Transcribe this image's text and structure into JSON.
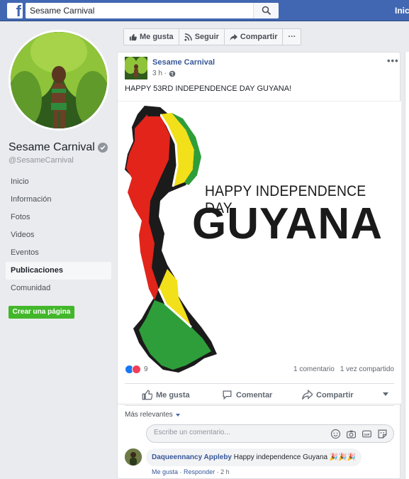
{
  "topbar": {
    "search_value": "Sesame Carnival",
    "right_link": "Inic"
  },
  "page": {
    "name": "Sesame Carnival",
    "handle": "@SesameCarnival",
    "nav": [
      {
        "label": "Inicio",
        "active": false
      },
      {
        "label": "Información",
        "active": false
      },
      {
        "label": "Fotos",
        "active": false
      },
      {
        "label": "Videos",
        "active": false
      },
      {
        "label": "Eventos",
        "active": false
      },
      {
        "label": "Publicaciones",
        "active": true
      },
      {
        "label": "Comunidad",
        "active": false
      }
    ],
    "create_page_label": "Crear una página"
  },
  "action_bar": {
    "like": "Me gusta",
    "follow": "Seguir",
    "share": "Compartir",
    "more": "···"
  },
  "post": {
    "author": "Sesame Carnival",
    "time": "3 h ·",
    "more": "•••",
    "text": "HAPPY 53RD INDEPENDENCE DAY GUYANA!",
    "image": {
      "line1": "HAPPY INDEPENDENCE DAY",
      "line2": "GUYANA"
    },
    "reaction_count": "9",
    "comments": "1 comentario",
    "shares": "1 vez compartido",
    "buttons": {
      "like": "Me gusta",
      "comment": "Comentar",
      "share": "Compartir"
    },
    "sort_label": "Más relevantes",
    "comment_placeholder": "Escribe un comentario...",
    "reply": {
      "name": "Daqueennancy Appleby",
      "text": "Happy independence Guyana",
      "emoji": "🎉🎉🎉",
      "like": "Me gusta",
      "reply": "Responder",
      "time": "2 h"
    }
  },
  "colors": {
    "brand": "#4267b2",
    "link": "#385898",
    "green": "#42b72a",
    "flag_green": "#2e9e3a",
    "flag_yellow": "#f2e01a",
    "flag_red": "#e2241b"
  }
}
